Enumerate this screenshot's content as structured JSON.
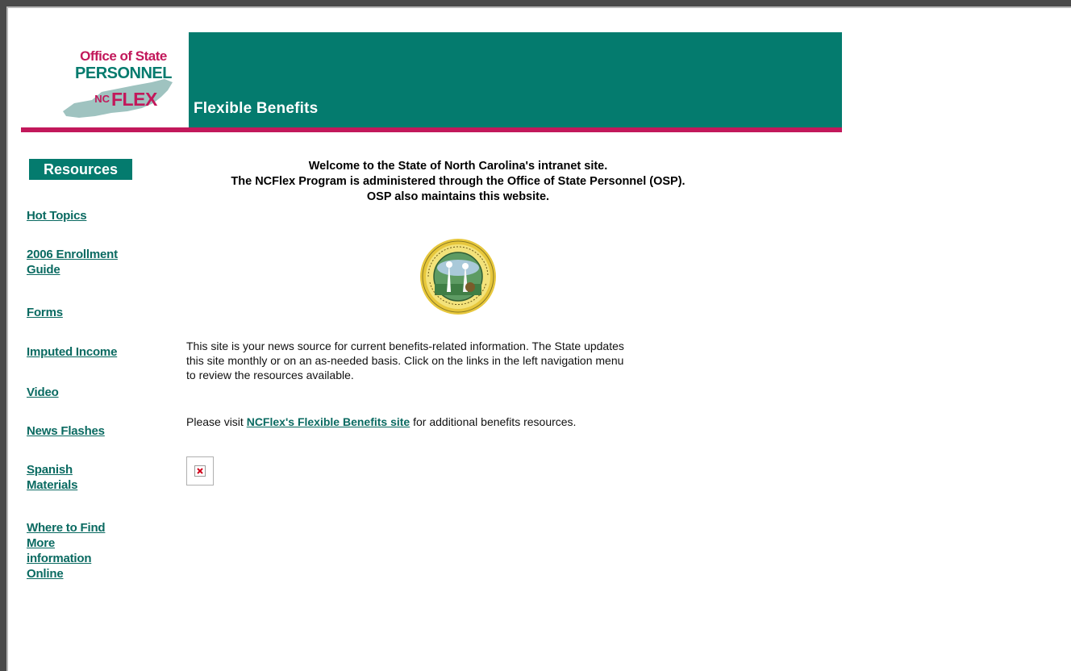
{
  "logo": {
    "line1": "Office of State",
    "line2": "PERSONNEL",
    "badge_nc": "NC",
    "badge_flex": "FLEX",
    "colors": {
      "pink": "#c2185b",
      "teal": "#047b6e",
      "map": "#9fc3c0"
    }
  },
  "header": {
    "title": "Flexible Benefits",
    "bar_color": "#047b6e",
    "rule_color": "#c2185b"
  },
  "sidebar": {
    "heading": "Resources",
    "items": [
      {
        "label": "Hot Topics"
      },
      {
        "label_lines": [
          "2006 Enrollment",
          "Guide"
        ]
      },
      {
        "label": "Forms"
      },
      {
        "label": "Imputed Income"
      },
      {
        "label": "Video"
      },
      {
        "label": "News Flashes"
      },
      {
        "label_lines": [
          "Spanish",
          "Materials"
        ]
      },
      {
        "label_lines": [
          "Where to Find",
          "More",
          "information",
          "Online"
        ]
      }
    ]
  },
  "content": {
    "welcome_lines": [
      "Welcome to the State of North Carolina's intranet site.",
      "The NCFlex Program is administered through the Office of State Personnel (OSP).",
      "OSP also maintains this website."
    ],
    "intro_lines": [
      "This site is your news source for current benefits-related information. The State updates",
      "this site monthly or on an as-needed basis. Click on the links in the left navigation menu",
      "to review the resources available."
    ],
    "visit_prefix": "Please visit ",
    "visit_link": "NCFlex's Flexible Benefits site",
    "visit_suffix": " for additional benefits resources.",
    "seal_icon": "north-carolina-state-seal",
    "broken_image_icon": "broken-image-icon"
  }
}
